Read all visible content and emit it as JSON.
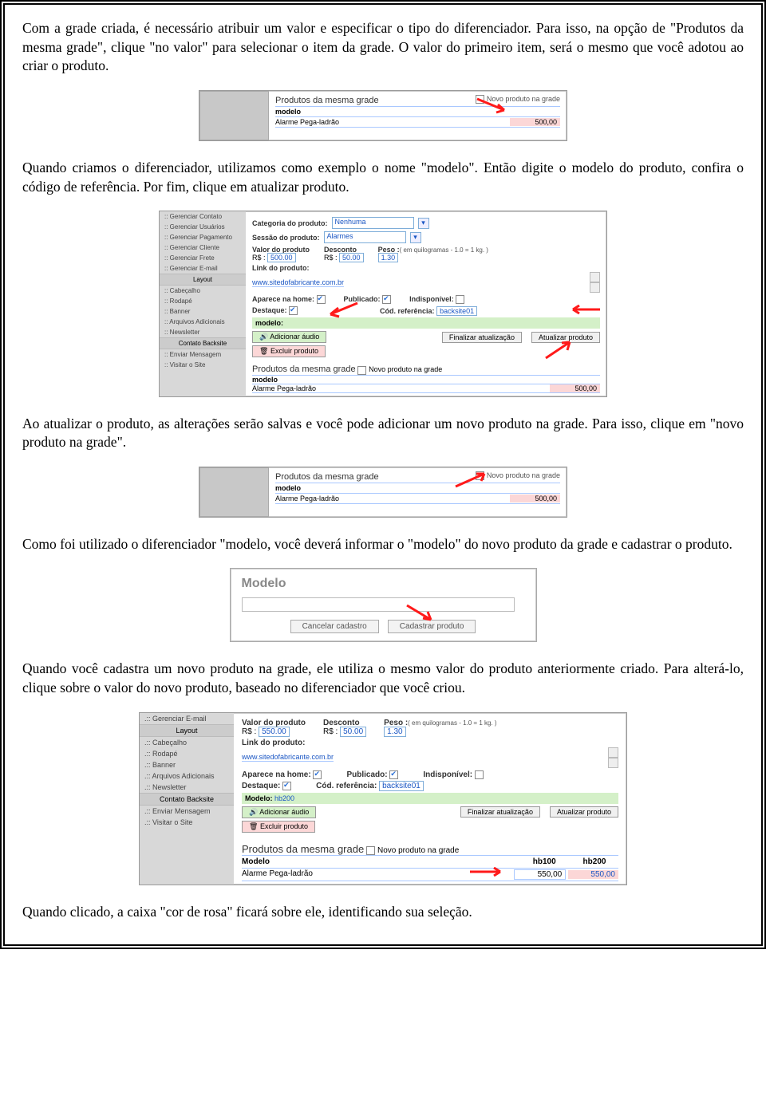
{
  "p1": "Com a grade criada, é necessário atribuir um valor e especificar o tipo do diferenciador. Para isso, na opção de \"Produtos da mesma grade\", clique \"no valor\" para selecionar o item da grade. O valor do primeiro item, será o mesmo que você adotou ao criar o produto.",
  "p2": "Quando criamos o diferenciador, utilizamos como exemplo o nome \"modelo\". Então digite o modelo do produto, confira o código de referência. Por fim, clique em atualizar produto.",
  "p3": "Ao atualizar o produto, as alterações serão salvas e você pode adicionar um novo produto na grade. Para isso, clique em \"novo produto na grade\".",
  "p4": "Como foi utilizado o diferenciador \"modelo, você deverá informar o \"modelo\" do novo produto da grade e cadastrar o produto.",
  "p5": "Quando você cadastra um novo produto na grade, ele utiliza o mesmo valor do produto anteriormente criado. Para alterá-lo, clique sobre o valor do novo produto, baseado no diferenciador que você criou.",
  "p6": "Quando clicado, a caixa \"cor de rosa\" ficará sobre ele, identificando sua seleção.",
  "grade": {
    "title": "Produtos da mesma grade",
    "newprod": "Novo produto na grade",
    "diff": "modelo",
    "diff_cap": "Modelo",
    "item": "Alarme Pega-ladrão",
    "price": "500,00"
  },
  "admin": {
    "side_items1": [
      "Gerenciar Contato",
      "Gerenciar Usuários",
      "Gerenciar Pagamento",
      "Gerenciar Cliente",
      "Gerenciar Frete",
      "Gerenciar E-mail"
    ],
    "side_layout": "Layout",
    "side_items2": [
      "Cabeçalho",
      "Rodapé",
      "Banner",
      "Arquivos Adicionais",
      "Newsletter"
    ],
    "side_contact": "Contato Backsite",
    "side_items3": [
      "Enviar Mensagem",
      "Visitar o Site"
    ],
    "cat": "Categoria do produto:",
    "cat_v": "Nenhuma",
    "ses": "Sessão do produto:",
    "ses_v": "Alarmes",
    "val": "Valor do produto",
    "val_v": "500.00",
    "desc": "Desconto",
    "desc_v": "50.00",
    "peso": "Peso :",
    "peso_hint": "( em quilogramas - 1.0 = 1 kg. )",
    "peso_v": "1.30",
    "link": "Link do produto:",
    "link_v": "www.sitedofabricante.com.br",
    "home": "Aparece na home:",
    "pub": "Publicado:",
    "indisp": "Indisponível:",
    "dest": "Destaque:",
    "cod": "Cód. referência:",
    "cod_v": "backsite01",
    "modelo": "modelo:",
    "add_audio": "Adicionar áudio",
    "excluir": "Excluir produto",
    "finalizar": "Finalizar atualização",
    "atualizar": "Atualizar produto",
    "rs": "R$ :"
  },
  "dlg": {
    "title": "Modelo",
    "cancel": "Cancelar cadastro",
    "ok": "Cadastrar produto"
  },
  "admin5": {
    "side_top": "Gerenciar E-mail",
    "val_v": "550.00",
    "desc_v": "50.00",
    "peso_v": "1.30",
    "modelo_label": "Modelo:",
    "modelo_v": "hb200",
    "cols": [
      "hb100",
      "hb200"
    ],
    "prices": [
      "550,00",
      "550,00"
    ]
  }
}
